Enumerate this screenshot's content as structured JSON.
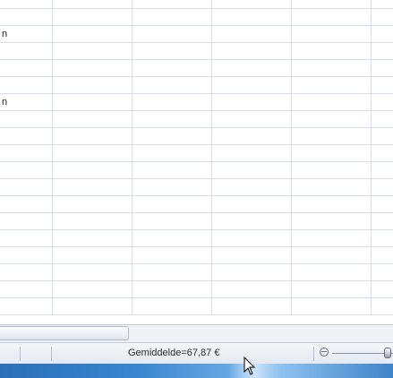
{
  "sheet": {
    "row_labels": [
      "'",
      "",
      "n",
      "",
      "",
      "",
      "n",
      "",
      "",
      "",
      "",
      "",
      "",
      "",
      "",
      "",
      "",
      "",
      ""
    ]
  },
  "statusbar": {
    "average_label": "Gemiddelde=67,87 €"
  },
  "icons": {
    "zoom_out": "zoom-out-icon",
    "cursor": "mouse-pointer-icon"
  },
  "colors": {
    "gridline": "#d9dde4",
    "statusbar": "#e4e9f1",
    "taskbar": "#3a86cf"
  }
}
